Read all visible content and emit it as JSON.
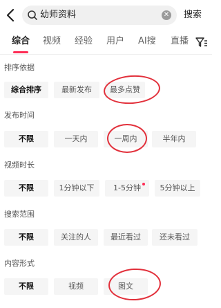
{
  "search": {
    "query": "幼师资料",
    "submit_label": "搜索"
  },
  "tabs": [
    {
      "label": "综合"
    },
    {
      "label": "视频"
    },
    {
      "label": "经验"
    },
    {
      "label": "用户"
    },
    {
      "label": "AI搜"
    },
    {
      "label": "直播"
    }
  ],
  "filters": {
    "sort": {
      "title": "排序依据",
      "options": [
        "综合排序",
        "最新发布",
        "最多点赞"
      ]
    },
    "time": {
      "title": "发布时间",
      "options": [
        "不限",
        "一天内",
        "一周内",
        "半年内"
      ]
    },
    "duration": {
      "title": "视频时长",
      "options": [
        "不限",
        "1分钟以下",
        "1-5分钟",
        "5分钟以上"
      ]
    },
    "scope": {
      "title": "搜索范围",
      "options": [
        "不限",
        "关注的人",
        "最近看过",
        "还未看过"
      ]
    },
    "content": {
      "title": "内容形式",
      "options": [
        "不限",
        "视频",
        "图文"
      ]
    }
  },
  "colors": {
    "accent": "#fe2c55",
    "annotation": "#e2303b"
  }
}
